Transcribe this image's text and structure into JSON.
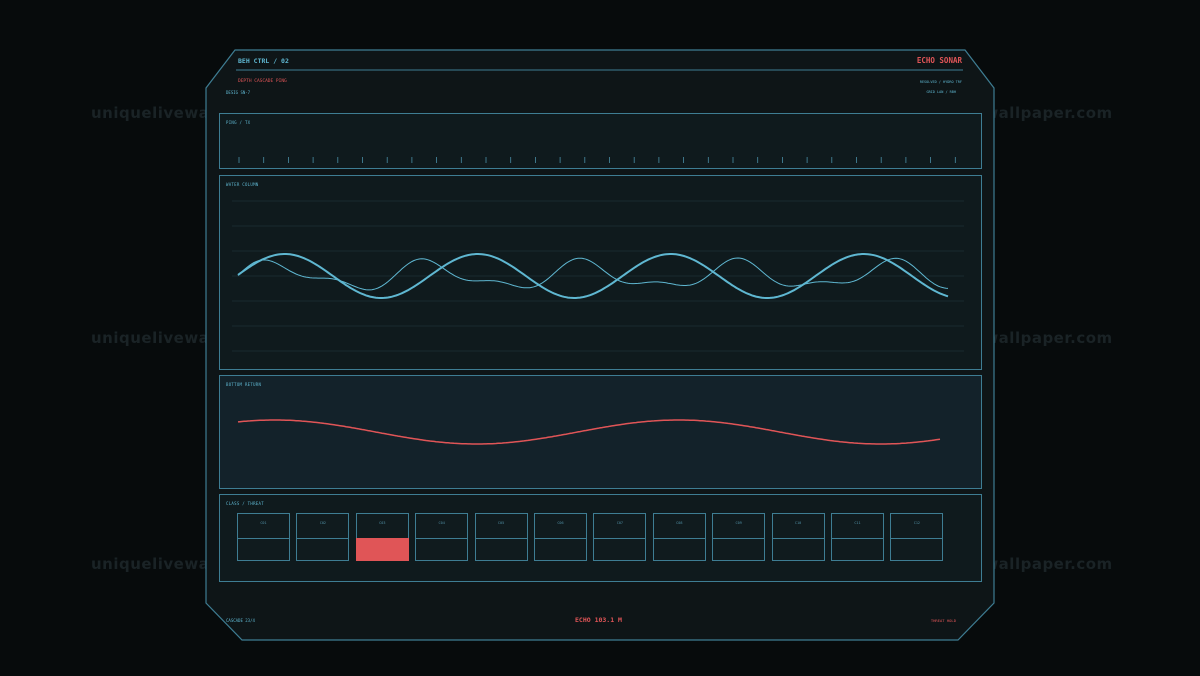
{
  "header": {
    "left_title": "BEH CTRL / 02",
    "right_title": "ECHO SONAR",
    "subtitle": "DEPTH CASCADE PING",
    "desig": "DESIG  SN-7",
    "right_meta1": "RESOLVED / HYDRO TRF",
    "right_meta2": "GRID  LAN / RBH"
  },
  "panels": {
    "ping": {
      "label": "PING  /  TX",
      "tick_count": 30
    },
    "water": {
      "label": "WATER  COLUMN"
    },
    "bottom": {
      "label": "BOTTOM  RETURN"
    },
    "classes": {
      "label": "CLASS  /  THREAT",
      "cells": [
        {
          "label": "C01"
        },
        {
          "label": "C02"
        },
        {
          "label": "C03"
        },
        {
          "label": "C04"
        },
        {
          "label": "C05"
        },
        {
          "label": "C06"
        },
        {
          "label": "C07"
        },
        {
          "label": "C08"
        },
        {
          "label": "C09"
        },
        {
          "label": "C10"
        },
        {
          "label": "C11"
        },
        {
          "label": "C12"
        }
      ],
      "active_index": 2
    }
  },
  "footer": {
    "left": "CASCADE  23/4",
    "center": "ECHO  103.1 M",
    "right": "THREAT  HOLD"
  },
  "watermark": "uniquelivewallpaper.com",
  "colors": {
    "accent": "#5fb7d1",
    "alert": "#e05557",
    "frame": "#3e7d93"
  }
}
